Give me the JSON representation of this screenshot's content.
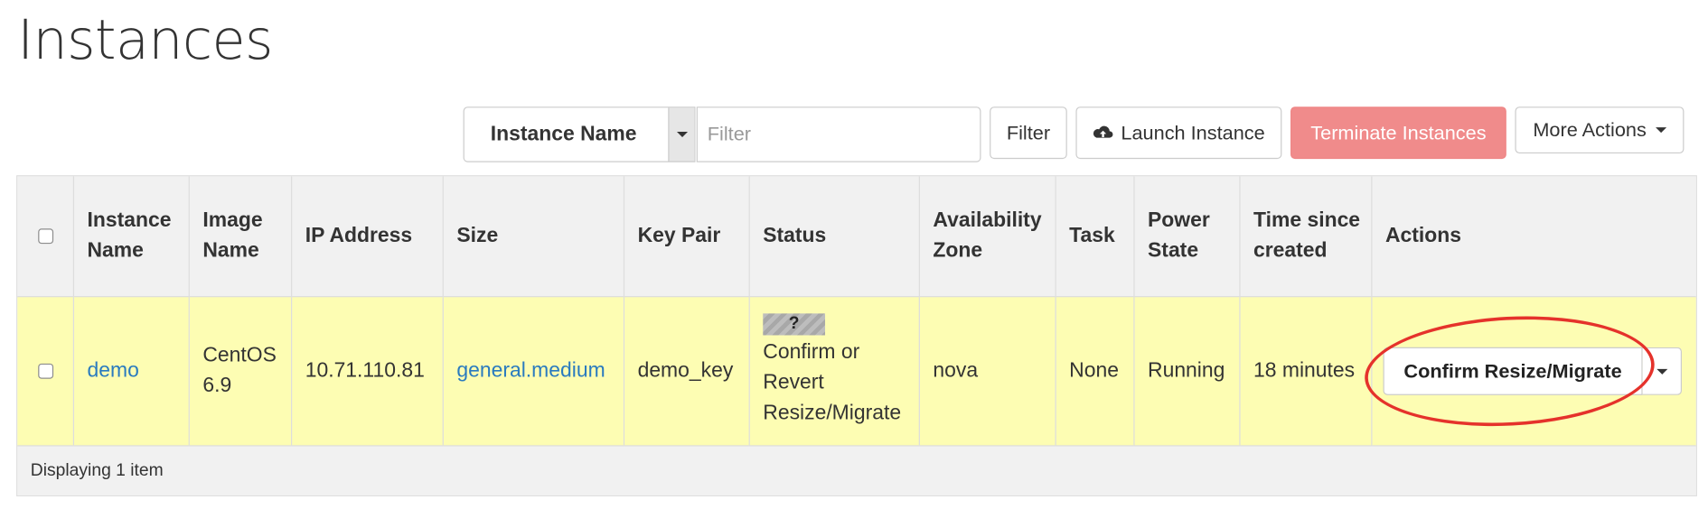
{
  "page": {
    "title": "Instances"
  },
  "toolbar": {
    "filter_field": {
      "value": "Instance Name"
    },
    "filter_input": {
      "placeholder": "Filter",
      "value": ""
    },
    "filter_button": "Filter",
    "launch_button": "Launch Instance",
    "terminate_button": "Terminate Instances",
    "more_actions_button": "More Actions",
    "icons": {
      "launch": "cloud-upload-icon",
      "more": "caret-down-icon"
    },
    "colors": {
      "terminate_bg": "#f08b8b"
    }
  },
  "table": {
    "columns": [
      {
        "label": ""
      },
      {
        "label": "Instance Name"
      },
      {
        "label": "Image Name"
      },
      {
        "label": "IP Address"
      },
      {
        "label": "Size"
      },
      {
        "label": "Key Pair"
      },
      {
        "label": "Status"
      },
      {
        "label": "Availability Zone"
      },
      {
        "label": "Task"
      },
      {
        "label": "Power State"
      },
      {
        "label": "Time since created"
      },
      {
        "label": "Actions"
      }
    ],
    "rows": [
      {
        "instance_name": "demo",
        "image_name": "CentOS 6.9",
        "ip_address": "10.71.110.81",
        "size": "general.medium",
        "key_pair": "demo_key",
        "status_icon": "?",
        "status": "Confirm or Revert Resize/Migrate",
        "availability_zone": "nova",
        "task": "None",
        "power_state": "Running",
        "time_since_created": "18 minutes",
        "action_button": "Confirm Resize/Migrate",
        "row_color": "#fdfdb3"
      }
    ],
    "footer": "Displaying 1 item"
  },
  "colors": {
    "link": "#2a7bbf",
    "highlight_ring": "#e5322b",
    "header_bg": "#f1f1f1"
  }
}
